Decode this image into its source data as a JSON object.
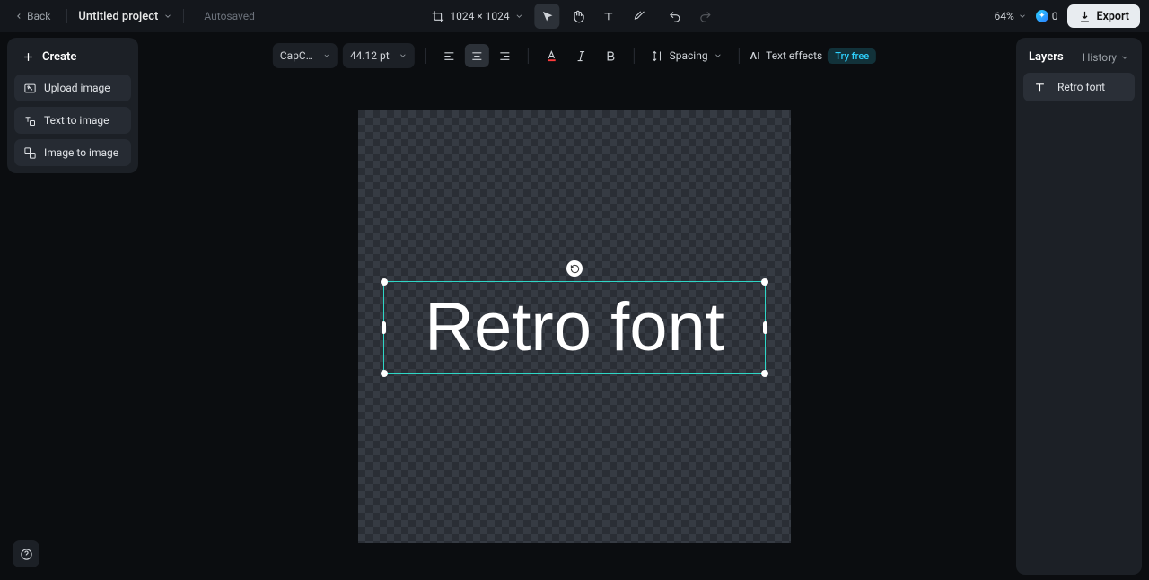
{
  "header": {
    "back_label": "Back",
    "project_name": "Untitled project",
    "autosaved_label": "Autosaved",
    "canvas_size_label": "1024 × 1024",
    "zoom_label": "64%",
    "credits_value": "0",
    "export_label": "Export"
  },
  "left_panel": {
    "create_label": "Create",
    "items": [
      {
        "label": "Upload image"
      },
      {
        "label": "Text to image"
      },
      {
        "label": "Image to image"
      }
    ]
  },
  "format_bar": {
    "font_name": "CapCut-…",
    "font_size": "44.12 pt",
    "spacing_label": "Spacing",
    "effects_label": "Text effects",
    "try_free_label": "Try free"
  },
  "canvas": {
    "text_value": "Retro font"
  },
  "right_panel": {
    "layers_label": "Layers",
    "history_label": "History",
    "layers": [
      {
        "label": "Retro font"
      }
    ]
  }
}
